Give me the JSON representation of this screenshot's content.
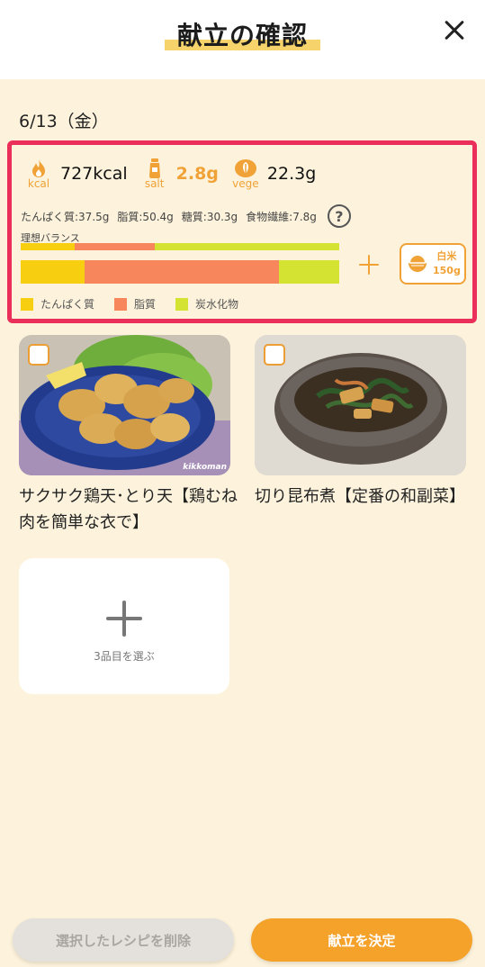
{
  "header": {
    "title": "献立の確認",
    "close_icon": "close-icon"
  },
  "menu_date": "6/13（金）",
  "nutrition": {
    "kcal": {
      "label": "kcal",
      "value": "727kcal",
      "icon": "flame-icon"
    },
    "salt": {
      "label": "salt",
      "value": "2.8g",
      "icon": "salt-shaker-icon"
    },
    "vege": {
      "label": "vege",
      "value": "22.3g",
      "icon": "leaf-icon"
    },
    "details": {
      "protein": "たんぱく質:37.5g",
      "fat": "脂質:50.4g",
      "sugar": "糖質:30.3g",
      "fiber": "食物繊維:7.8g"
    },
    "help_icon": "question-circle-icon",
    "ideal_label": "理想バランス",
    "ideal_balance": {
      "protein": 0.17,
      "fat": 0.25,
      "carbs": 0.58
    },
    "actual_balance": {
      "protein": 0.2,
      "fat": 0.61,
      "carbs": 0.19
    },
    "legend": [
      "たんぱく質",
      "脂質",
      "炭水化物"
    ],
    "colors": {
      "protein": "#f7cf10",
      "fat": "#f7865c",
      "carbs": "#d4e232"
    }
  },
  "rice": {
    "label": "白米",
    "amount": "150g",
    "icon": "rice-bowl-icon"
  },
  "recipes": [
    {
      "title": "サクサク鶏天･とり天【鶏むね肉を簡単な衣で】",
      "photo_mark": "kikkoman"
    },
    {
      "title": "切り昆布煮【定番の和副菜】"
    }
  ],
  "add_slot": {
    "label": "3品目を選ぶ"
  },
  "buttons": {
    "delete": "選択したレシピを削除",
    "decide": "献立を決定"
  }
}
